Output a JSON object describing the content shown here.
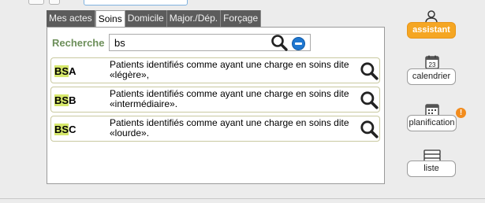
{
  "tabs": [
    {
      "label": "Mes actes",
      "active": false
    },
    {
      "label": "Soins",
      "active": true
    },
    {
      "label": "Domicile",
      "active": false
    },
    {
      "label": "Major./Dép.",
      "active": false
    },
    {
      "label": "Forçage",
      "active": false
    }
  ],
  "search": {
    "label": "Recherche",
    "value": "bs"
  },
  "results": [
    {
      "code_highlight": "BS",
      "code_rest": "A",
      "desc_line1": "Patients identifiés comme ayant une charge en soins dite",
      "desc_line2": "«légère»,"
    },
    {
      "code_highlight": "BS",
      "code_rest": "B",
      "desc_line1": "Patients identifiés comme ayant une charge en soins dite",
      "desc_line2": "«intermédiaire»."
    },
    {
      "code_highlight": "BS",
      "code_rest": "C",
      "desc_line1": "Patients identifiés comme ayant une charge en soins dite",
      "desc_line2": "«lourde»."
    }
  ],
  "side_buttons": {
    "assistant": "assistant",
    "calendrier": "calendrier",
    "calendar_day": "23",
    "planification": "planification",
    "planification_badge": "!",
    "liste": "liste"
  },
  "colors": {
    "accent": "#f5a623",
    "highlight": "#d6e86b",
    "search_label": "#6d8f5a",
    "tab_bg": "#5c5c5c"
  },
  "icons": {
    "search": "magnifier-icon",
    "collapse": "minus-circle-icon",
    "assistant": "user-icon",
    "calendrier": "calendar-icon",
    "planification": "planning-calendar-icon",
    "liste": "list-icon"
  }
}
